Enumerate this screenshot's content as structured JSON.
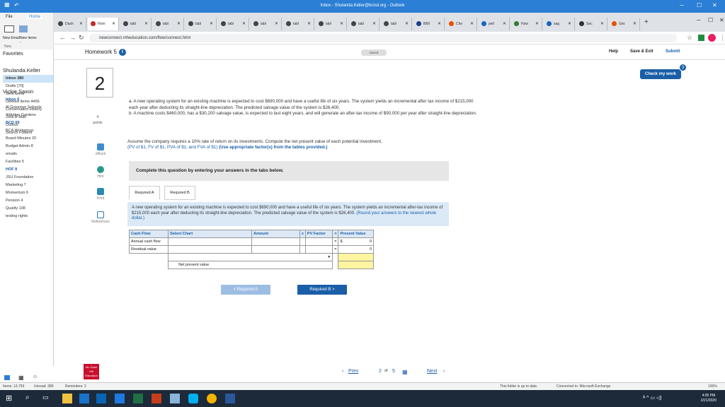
{
  "window": {
    "title": "Inbox - Shulanda.Keller@bcisd.org - Outlook"
  },
  "ribbon": {
    "tabs": [
      "File",
      "Home"
    ],
    "new_email": "New Email",
    "new_items": "New Items -",
    "new_group": "New"
  },
  "folders": {
    "favorites": "Favorites",
    "account1": "Shulanda.Keller",
    "items": [
      {
        "label": "Inbox 380",
        "style": "bold"
      },
      {
        "label": "Drafts [70]",
        "style": ""
      },
      {
        "label": "Sent Items",
        "style": ""
      },
      {
        "label": "Deleted Items 4456",
        "style": ""
      },
      {
        "label": "Conversation History",
        "style": ""
      },
      {
        "label": "Junk E-Mail",
        "style": ""
      },
      {
        "label": "Outbox",
        "style": ""
      },
      {
        "label": "Search Folders",
        "style": ""
      }
    ],
    "account2": "Vickie Saxon",
    "items2": [
      {
        "label": "Inbox 6",
        "style": "blue"
      },
      {
        "label": "Al Governor Schools",
        "style": ""
      },
      {
        "label": "Aldridge Gardens",
        "style": ""
      },
      {
        "label": "BCD 69",
        "style": "blue"
      },
      {
        "label": "BCA Workgroup",
        "style": ""
      },
      {
        "label": "Board Minutes 20",
        "style": ""
      },
      {
        "label": "Budget Admin 8",
        "style": ""
      },
      {
        "label": "emails",
        "style": ""
      },
      {
        "label": "Facilities 5",
        "style": ""
      },
      {
        "label": "HOF 8",
        "style": "blue"
      },
      {
        "label": "JSU Foundation",
        "style": ""
      },
      {
        "label": "Marketing 7",
        "style": ""
      },
      {
        "label": "Momentum 6",
        "style": ""
      },
      {
        "label": "Pension 4",
        "style": ""
      },
      {
        "label": "Quality 108",
        "style": ""
      },
      {
        "label": "testing rights",
        "style": ""
      }
    ]
  },
  "browser": {
    "tabs": [
      "Dash",
      "Hom",
      "tabl",
      "tabl",
      "tabl",
      "tabl",
      "tabl",
      "tabl",
      "tabl",
      "tabl",
      "tabl",
      "BMI",
      "Che",
      "pell",
      "How",
      "sag",
      "Sec",
      "Get"
    ],
    "url": "newconnect.mheducation.com/flow/connect.html"
  },
  "app": {
    "title": "Homework 5",
    "info": "i",
    "saved": "Saved",
    "help": "Help",
    "save_exit": "Save & Exit",
    "submit": "Submit",
    "check_my_work": "Check my work",
    "check_count": "3"
  },
  "question": {
    "number": "2",
    "points_value": "4",
    "points_label": "points",
    "part_a": "a. A new operating system for an existing machine is expected to cost $690,000 and have a useful life of six years. The system yields an incremental after tax income of $215,000 each year after deducting its straight-line depreciation. The predicted salvage value of the system is $26,400.",
    "part_b": "b. A machine costs $460,000, has a $30,200 salvage value, is expected to last eight years, and will generate an after-tax income of $90,000 per year after straight-line depreciation.",
    "assume": "Assume the company requires a 10% rate of return on its investments. Compute the net present value of each potential investment.",
    "tables_links": "(PV of $1, FV of $1, PVA of $1, and FVA of $1)",
    "tables_note": "(Use appropriate factor(s) from the tables provided.)",
    "side_ebook": "eBook",
    "side_hint": "Hint",
    "side_print": "Print",
    "side_references": "References",
    "complete": "Complete this question by entering your answers in the tabs below.",
    "req_tabs": [
      "Required A",
      "Required B"
    ],
    "req_text": "A new operating system for an existing machine is expected to cost $690,000 and have a useful life of six years. The system yields an incremental after-tax income of $215,000 each year after deducting its straight-line depreciation. The predicted salvage value of the system is $26,400.",
    "req_round": "(Round your answers to the nearest whole dollar.)"
  },
  "table": {
    "headers": [
      "Cash Flow",
      "Select Chart",
      "Amount",
      "x",
      "PV Factor",
      "=",
      "Present Value"
    ],
    "rows": [
      {
        "flow": "Annual cash flow",
        "eq": "=",
        "cur": "$",
        "pv": "0"
      },
      {
        "flow": "Residual value",
        "eq": "=",
        "cur": "",
        "pv": "0"
      }
    ],
    "npv_label": "Net present value"
  },
  "nav": {
    "prev_req": "< Required A",
    "next_req": "Required B >",
    "prev": "Prev",
    "page_current": "2",
    "page_of": "of",
    "page_total": "5",
    "next": "Next"
  },
  "mh_logo": "Mc Graw Hill Education",
  "status": {
    "items": "Items: 13,793",
    "unread": "Unread: 380",
    "reminders": "Reminders: 2",
    "sync": "This folder is up to date.",
    "connected": "Connected to: Microsoft Exchange",
    "zoom": "100%"
  },
  "clock": {
    "time": "4:05 PM",
    "date": "2/21/2020"
  }
}
